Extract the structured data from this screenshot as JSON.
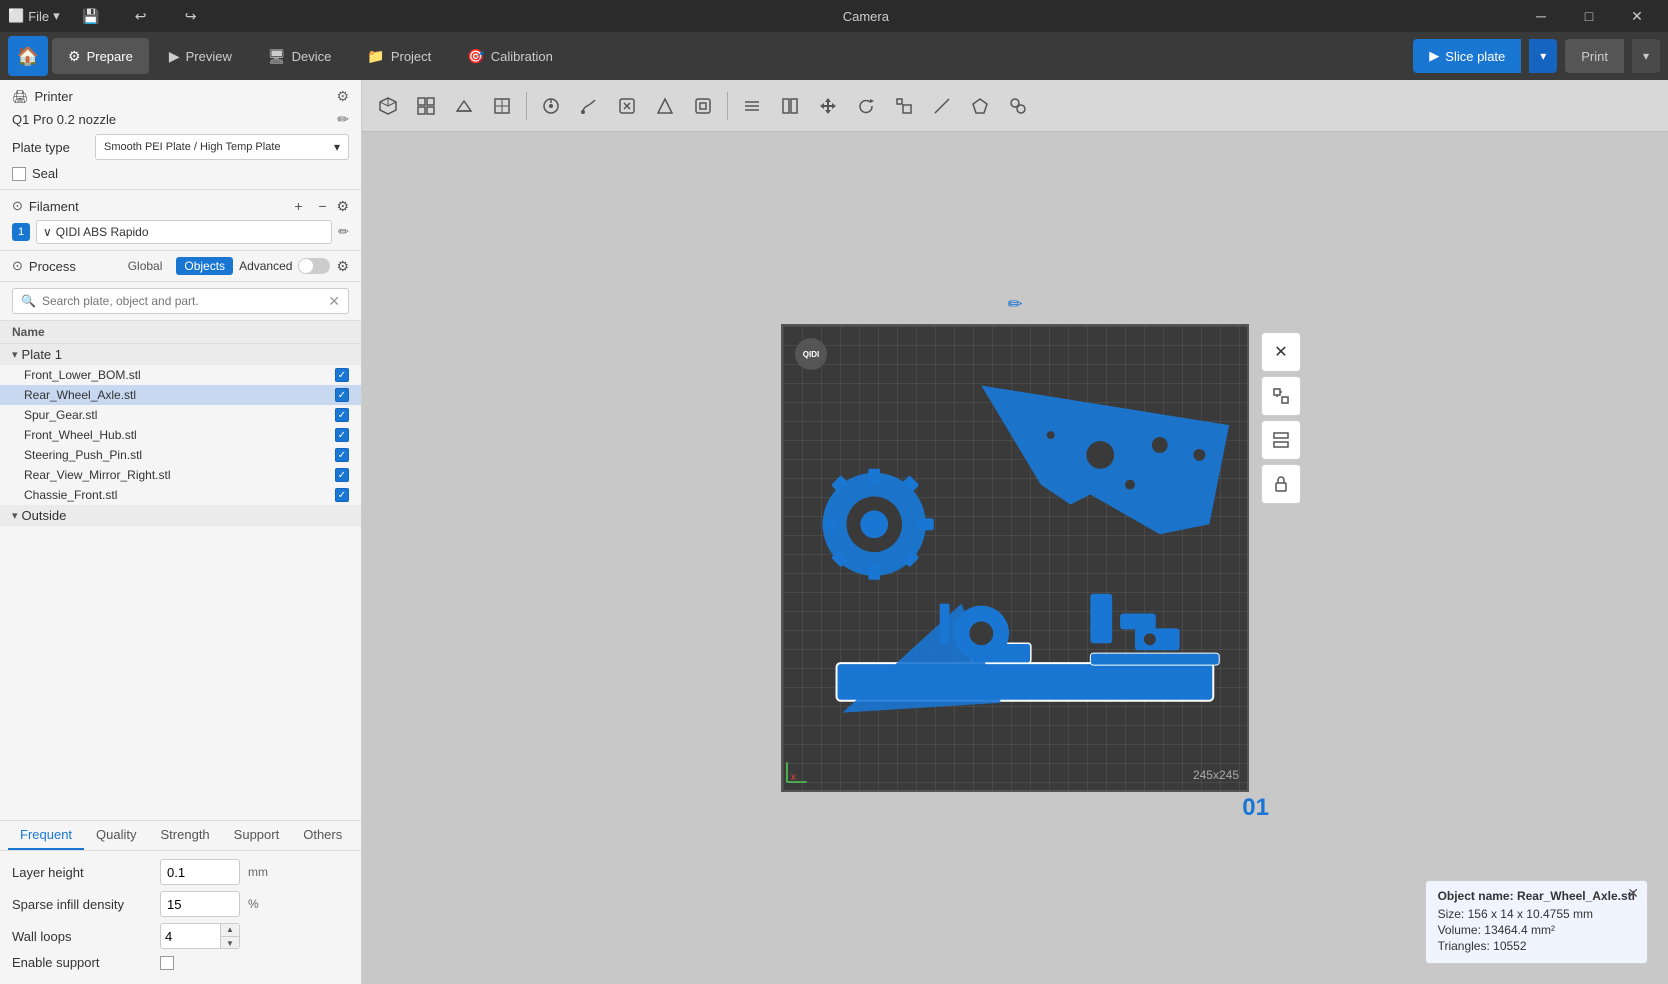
{
  "titlebar": {
    "file_label": "File",
    "title": "Camera",
    "minimize": "─",
    "maximize": "□",
    "close": "✕"
  },
  "topnav": {
    "prepare_label": "Prepare",
    "preview_label": "Preview",
    "device_label": "Device",
    "project_label": "Project",
    "calibration_label": "Calibration",
    "slice_label": "Slice plate",
    "print_label": "Print"
  },
  "left_panel": {
    "printer_label": "Printer",
    "printer_model": "Q1 Pro 0.2 nozzle",
    "plate_type_label": "Plate type",
    "plate_type_value": "Smooth PEI Plate / High Temp Plate",
    "seal_label": "Seal",
    "filament_label": "Filament",
    "filament_item_num": "1",
    "filament_item_name": "QIDI ABS Rapido",
    "process_label": "Process",
    "global_tab": "Global",
    "objects_tab": "Objects",
    "advanced_label": "Advanced",
    "search_placeholder": "Search plate, object and part.",
    "tree_header_name": "Name",
    "plate_label": "Plate 1",
    "objects": [
      {
        "name": "Front_Lower_BOM.stl",
        "checked": true,
        "selected": false
      },
      {
        "name": "Rear_Wheel_Axle.stl",
        "checked": true,
        "selected": true
      },
      {
        "name": "Spur_Gear.stl",
        "checked": true,
        "selected": false
      },
      {
        "name": "Front_Wheel_Hub.stl",
        "checked": true,
        "selected": false
      },
      {
        "name": "Steering_Push_Pin.stl",
        "checked": true,
        "selected": false
      },
      {
        "name": "Rear_View_Mirror_Right.stl",
        "checked": true,
        "selected": false
      },
      {
        "name": "Chassie_Front.stl",
        "checked": true,
        "selected": false
      }
    ],
    "outside_label": "Outside",
    "settings_tabs": [
      "Frequent",
      "Quality",
      "Strength",
      "Support",
      "Others"
    ],
    "active_tab": "Frequent",
    "settings": {
      "layer_height_label": "Layer height",
      "layer_height_value": "0.1",
      "layer_height_unit": "mm",
      "sparse_infill_label": "Sparse infill density",
      "sparse_infill_value": "15",
      "sparse_infill_unit": "%",
      "wall_loops_label": "Wall loops",
      "wall_loops_value": "4",
      "enable_support_label": "Enable support"
    }
  },
  "viewport": {
    "plate_size": "245x245",
    "plate_number": "01",
    "edit_icon": "✏",
    "info": {
      "object_name_label": "Object name:",
      "object_name": "Rear_Wheel_Axle.stl",
      "size_label": "Size:",
      "size_value": "156 x 14 x 10.4755 mm",
      "volume_label": "Volume:",
      "volume_value": "13464.4 mm²",
      "triangles_label": "Triangles:",
      "triangles_value": "10552"
    }
  },
  "toolbar": {
    "icons": [
      "⬡",
      "⊞",
      "⊿",
      "▣",
      "⊙",
      "✂",
      "⬭",
      "☰",
      "⊕",
      "✑",
      "⬤",
      "◈",
      "⊡",
      "◻",
      "⊟",
      "▦",
      "⊠",
      "⊤",
      "✒",
      "⊻",
      "━",
      "⊡",
      "⊙"
    ]
  }
}
